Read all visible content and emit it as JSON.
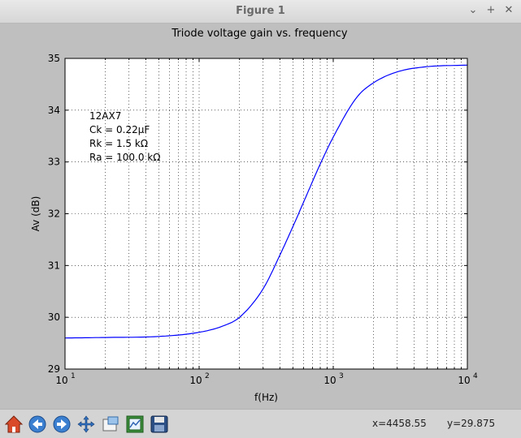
{
  "window": {
    "title": "Figure 1",
    "minimize_glyph": "⌄",
    "maximize_glyph": "+",
    "close_glyph": "✕"
  },
  "toolbar": {
    "buttons": [
      {
        "name": "home-icon",
        "icon": "home"
      },
      {
        "name": "back-icon",
        "icon": "arrow-left"
      },
      {
        "name": "forward-icon",
        "icon": "arrow-right"
      },
      {
        "name": "pan-icon",
        "icon": "move-arrows"
      },
      {
        "name": "zoom-icon",
        "icon": "zoom-rect"
      },
      {
        "name": "subplots-icon",
        "icon": "configure-subplots"
      },
      {
        "name": "save-icon",
        "icon": "floppy-disk"
      }
    ],
    "x_readout": "x=4458.55",
    "y_readout": "y=29.875"
  },
  "chart_data": {
    "type": "line",
    "title": "Triode voltage gain vs. frequency",
    "xlabel": "f(Hz)",
    "ylabel": "Av (dB)",
    "xscale": "log",
    "xlim": [
      10,
      10000
    ],
    "ylim": [
      29,
      35
    ],
    "grid": true,
    "x_tick_labels": [
      {
        "base": "10",
        "exp": "1"
      },
      {
        "base": "10",
        "exp": "2"
      },
      {
        "base": "10",
        "exp": "3"
      },
      {
        "base": "10",
        "exp": "4"
      }
    ],
    "y_ticks": [
      29,
      30,
      31,
      32,
      33,
      34,
      35
    ],
    "annotation": [
      "12AX7",
      "Ck = 0.22μF",
      "Rk = 1.5 kΩ",
      "Ra = 100.0 kΩ"
    ],
    "series": [
      {
        "color": "#0000ff",
        "x": [
          10,
          20,
          50,
          100,
          150,
          200,
          300,
          400,
          500,
          600,
          700,
          800,
          1000,
          1500,
          2000,
          3000,
          5000,
          10000
        ],
        "y": [
          29.6,
          29.61,
          29.63,
          29.71,
          29.83,
          30.0,
          30.55,
          31.2,
          31.75,
          32.22,
          32.62,
          32.96,
          33.48,
          34.25,
          34.53,
          34.74,
          34.84,
          34.87
        ]
      }
    ]
  }
}
